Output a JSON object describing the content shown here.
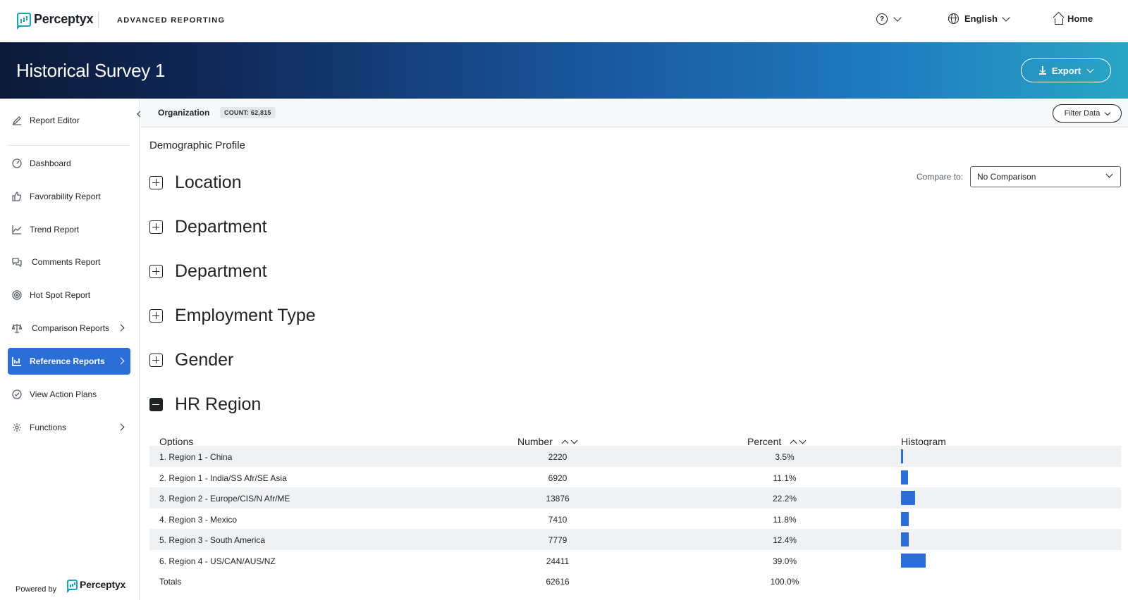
{
  "app": {
    "brand": "Perceptyx",
    "section_name": "ADVANCED REPORTING"
  },
  "topnav": {
    "language": "English",
    "home": "Home"
  },
  "banner": {
    "title": "Historical Survey 1",
    "export_label": "Export"
  },
  "sidebar": {
    "items": [
      {
        "label": "Report Editor",
        "icon": "pencil-icon"
      },
      {
        "label": "Dashboard",
        "icon": "gauge-icon"
      },
      {
        "label": "Favorability Report",
        "icon": "thumbs-up-icon"
      },
      {
        "label": "Trend Report",
        "icon": "trend-line-icon"
      },
      {
        "label": "Comments Report",
        "icon": "chat-bubbles-icon"
      },
      {
        "label": "Hot Spot Report",
        "icon": "target-icon"
      },
      {
        "label": "Comparison Reports",
        "icon": "scale-icon"
      },
      {
        "label": "Reference Reports",
        "icon": "bar-chart-icon",
        "active": true
      },
      {
        "label": "View Action Plans",
        "icon": "check-circle-icon"
      },
      {
        "label": "Functions",
        "icon": "gear-icon"
      }
    ],
    "powered_by": "Powered by",
    "powered_brand": "Perceptyx"
  },
  "filterbar": {
    "org_label": "Organization",
    "count_badge": "COUNT: 62,815",
    "filter_button": "Filter Data"
  },
  "content": {
    "title": "Demographic Profile",
    "compare_label": "Compare to:",
    "compare_value": "No Comparison",
    "sections": [
      {
        "title": "Location",
        "expanded": false
      },
      {
        "title": "Department",
        "expanded": false
      },
      {
        "title": "Department",
        "expanded": false
      },
      {
        "title": "Employment Type",
        "expanded": false
      },
      {
        "title": "Gender",
        "expanded": false
      },
      {
        "title": "HR Region",
        "expanded": true
      }
    ],
    "table": {
      "headers": {
        "options": "Options",
        "number": "Number",
        "percent": "Percent",
        "histogram": "Histogram"
      },
      "rows": [
        {
          "option": "1. Region 1 - China",
          "number": "2220",
          "percent": "3.5%",
          "pct_value": 3.5
        },
        {
          "option": "2. Region 1 - India/SS Afr/SE Asia",
          "number": "6920",
          "percent": "11.1%",
          "pct_value": 11.1
        },
        {
          "option": "3. Region 2 - Europe/CIS/N Afr/ME",
          "number": "13876",
          "percent": "22.2%",
          "pct_value": 22.2
        },
        {
          "option": "4. Region 3 - Mexico",
          "number": "7410",
          "percent": "11.8%",
          "pct_value": 11.8
        },
        {
          "option": "5. Region 3 - South America",
          "number": "7779",
          "percent": "12.4%",
          "pct_value": 12.4
        },
        {
          "option": "6. Region 4 - US/CAN/AUS/NZ",
          "number": "24411",
          "percent": "39.0%",
          "pct_value": 39.0
        }
      ],
      "totals": {
        "label": "Totals",
        "number": "62616",
        "percent": "100.0%"
      }
    },
    "colors": {
      "accent": "#2b6fd6",
      "histogram": "#2b6fd6"
    }
  }
}
